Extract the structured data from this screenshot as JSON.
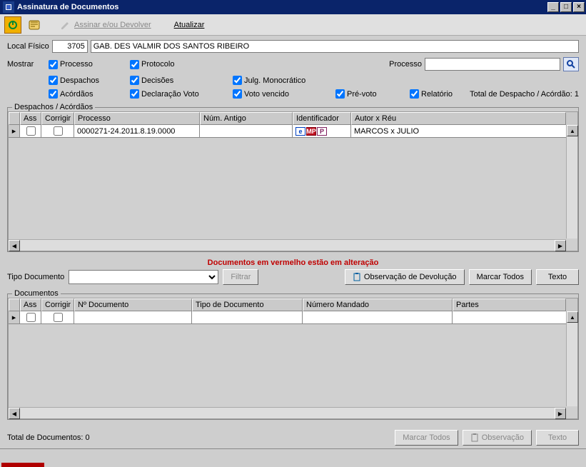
{
  "window": {
    "title": "Assinatura de Documentos"
  },
  "toolbar": {
    "assinar_label": "Assinar e/ou Devolver",
    "atualizar_label": "Atualizar"
  },
  "local": {
    "label": "Local Físico",
    "code": "3705",
    "name": "GAB. DES VALMIR DOS SANTOS RIBEIRO"
  },
  "mostrar": {
    "label": "Mostrar",
    "processo_label": "Processo",
    "protocolo_label": "Protocolo",
    "despachos_label": "Despachos",
    "decisoes_label": "Decisões",
    "julg_mono_label": "Julg. Monocrático",
    "acordaos_label": "Acórdãos",
    "decl_voto_label": "Declaração Voto",
    "voto_vencido_label": "Voto vencido",
    "pre_voto_label": "Pré-voto",
    "relatorio_label": "Relatório",
    "processo_search_label": "Processo",
    "total_label": "Total de Despacho / Acórdão: 1"
  },
  "grid1": {
    "legend": "Despachos / Acórdãos",
    "cols": {
      "ass": "Ass",
      "corrigir": "Corrigir",
      "processo": "Processo",
      "num_antigo": "Núm. Antigo",
      "identificador": "Identificador",
      "autor_reu": "Autor x Réu"
    },
    "rows": [
      {
        "processo": "0000271-24.2011.8.19.0000",
        "num_antigo": "",
        "autor_reu": "MARCOS x JULIO"
      }
    ]
  },
  "red_msg": "Documentos em vermelho estão em alteração",
  "mid": {
    "tipo_doc_label": "Tipo Documento",
    "filtrar": "Filtrar",
    "obs_dev": "Observação de Devolução",
    "marcar_todos": "Marcar Todos",
    "texto": "Texto"
  },
  "grid2": {
    "legend": "Documentos",
    "cols": {
      "ass": "Ass",
      "corrigir": "Corrigir",
      "num_doc": "Nº Documento",
      "tipo_doc": "Tipo de Documento",
      "num_mandado": "Número Mandado",
      "partes": "Partes"
    }
  },
  "footer": {
    "total_docs": "Total de Documentos: 0",
    "marcar_todos": "Marcar Todos",
    "observacao": "Observação",
    "texto": "Texto"
  },
  "icons": {
    "power": "power-icon",
    "refresh": "refresh-icon",
    "sign": "sign-icon",
    "search": "search-icon",
    "clipboard": "clipboard-icon"
  }
}
